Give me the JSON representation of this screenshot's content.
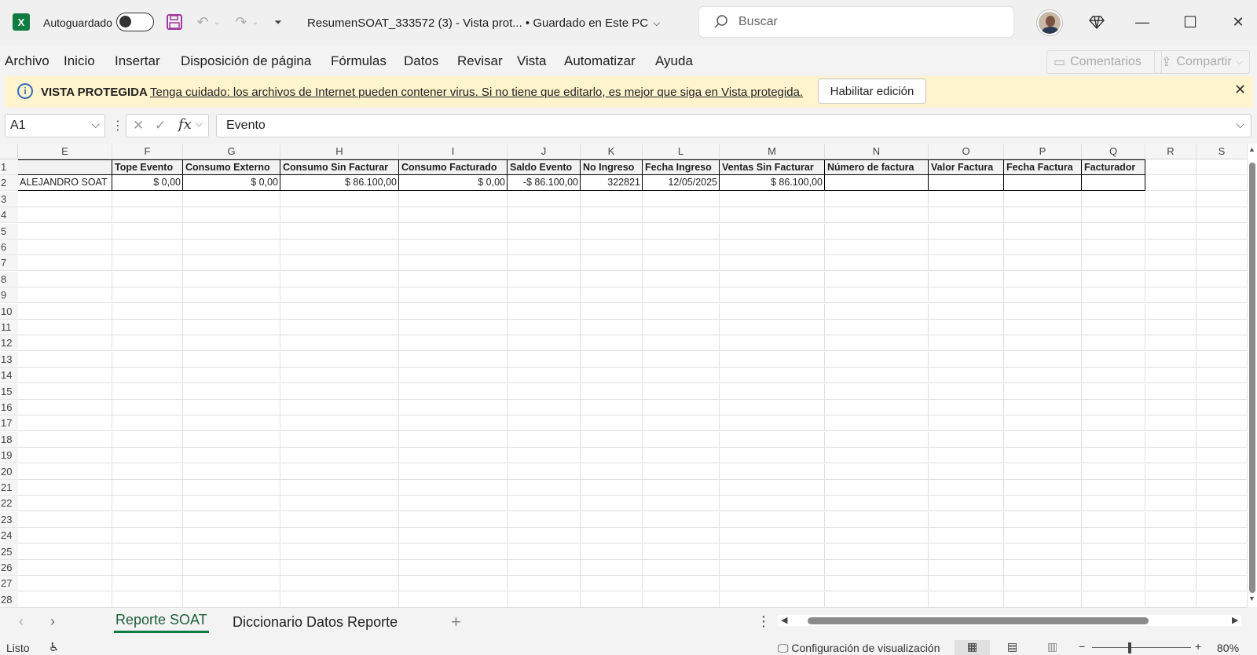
{
  "titlebar": {
    "autosave_label": "Autoguardado",
    "doc_title": "ResumenSOAT_333572 (3)  -  Vista prot...  •  Guardado en Este PC",
    "search_placeholder": "Buscar",
    "minimize": "—",
    "maximize": "☐",
    "close": "✕"
  },
  "menu": {
    "items": [
      "Archivo",
      "Inicio",
      "Insertar",
      "Disposición de página",
      "Fórmulas",
      "Datos",
      "Revisar",
      "Vista",
      "Automatizar",
      "Ayuda"
    ],
    "comments": "Comentarios",
    "share": "Compartir"
  },
  "protected_bar": {
    "title": "VISTA PROTEGIDA",
    "message": "Tenga cuidado: los archivos de Internet pueden contener virus. Si no tiene que editarlo, es mejor que siga en Vista protegida.",
    "enable_button": "Habilitar edición"
  },
  "formula_bar": {
    "cell_ref": "A1",
    "fx": "fx",
    "content": "Evento"
  },
  "grid": {
    "columns": [
      "E",
      "F",
      "G",
      "H",
      "I",
      "J",
      "K",
      "L",
      "M",
      "N",
      "O",
      "P",
      "Q",
      "R",
      "S"
    ],
    "rows": [
      "1",
      "2",
      "3",
      "4",
      "5",
      "6",
      "7",
      "8",
      "9",
      "10",
      "11",
      "12",
      "13",
      "14",
      "15",
      "16",
      "17",
      "18",
      "19",
      "20",
      "21",
      "22",
      "23",
      "24",
      "25",
      "26",
      "27",
      "28"
    ],
    "headers": [
      "",
      "Tope Evento",
      "Consumo Externo",
      "Consumo Sin Facturar",
      "Consumo Facturado",
      "Saldo Evento",
      "No Ingreso",
      "Fecha Ingreso",
      "Ventas Sin Facturar",
      "Número de factura",
      "Valor Factura",
      "Fecha Factura",
      "Facturador"
    ],
    "row2": [
      "ALEJANDRO SOAT",
      "$ 0,00",
      "$ 0,00",
      "$ 86.100,00",
      "$ 0,00",
      "-$ 86.100,00",
      "322821",
      "12/05/2025",
      "$ 86.100,00",
      "",
      "",
      "",
      ""
    ]
  },
  "sheets": {
    "tabs": [
      "Reporte SOAT",
      "Diccionario Datos Reporte"
    ],
    "active": 0
  },
  "status": {
    "ready": "Listo",
    "display_settings": "Configuración de visualización",
    "zoom": "80%"
  }
}
